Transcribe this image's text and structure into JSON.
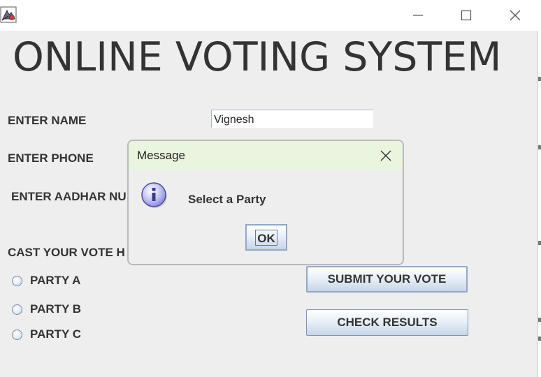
{
  "window": {
    "icons": {
      "app": "java-app-icon",
      "minimize": "minimize-icon",
      "maximize": "maximize-icon",
      "close": "close-icon"
    }
  },
  "main": {
    "heading": "ONLINE VOTING SYSTEM",
    "labels": {
      "name": "ENTER NAME",
      "phone": "ENTER PHONE",
      "aadhar": "ENTER AADHAR NU",
      "cast": "CAST YOUR VOTE H"
    },
    "name_value": "Vignesh",
    "parties": [
      {
        "label": "PARTY A"
      },
      {
        "label": "PARTY B"
      },
      {
        "label": "PARTY C"
      }
    ],
    "submit_label": "SUBMIT YOUR VOTE",
    "results_label": "CHECK RESULTS"
  },
  "dialog": {
    "title": "Message",
    "message": "Select a Party",
    "ok_label": "OK",
    "icons": {
      "info": "info-icon",
      "close": "close-icon"
    }
  },
  "colors": {
    "window_bg": "#eeeeee",
    "dialog_title_bg": "#eaf5e0",
    "text": "#333333"
  }
}
